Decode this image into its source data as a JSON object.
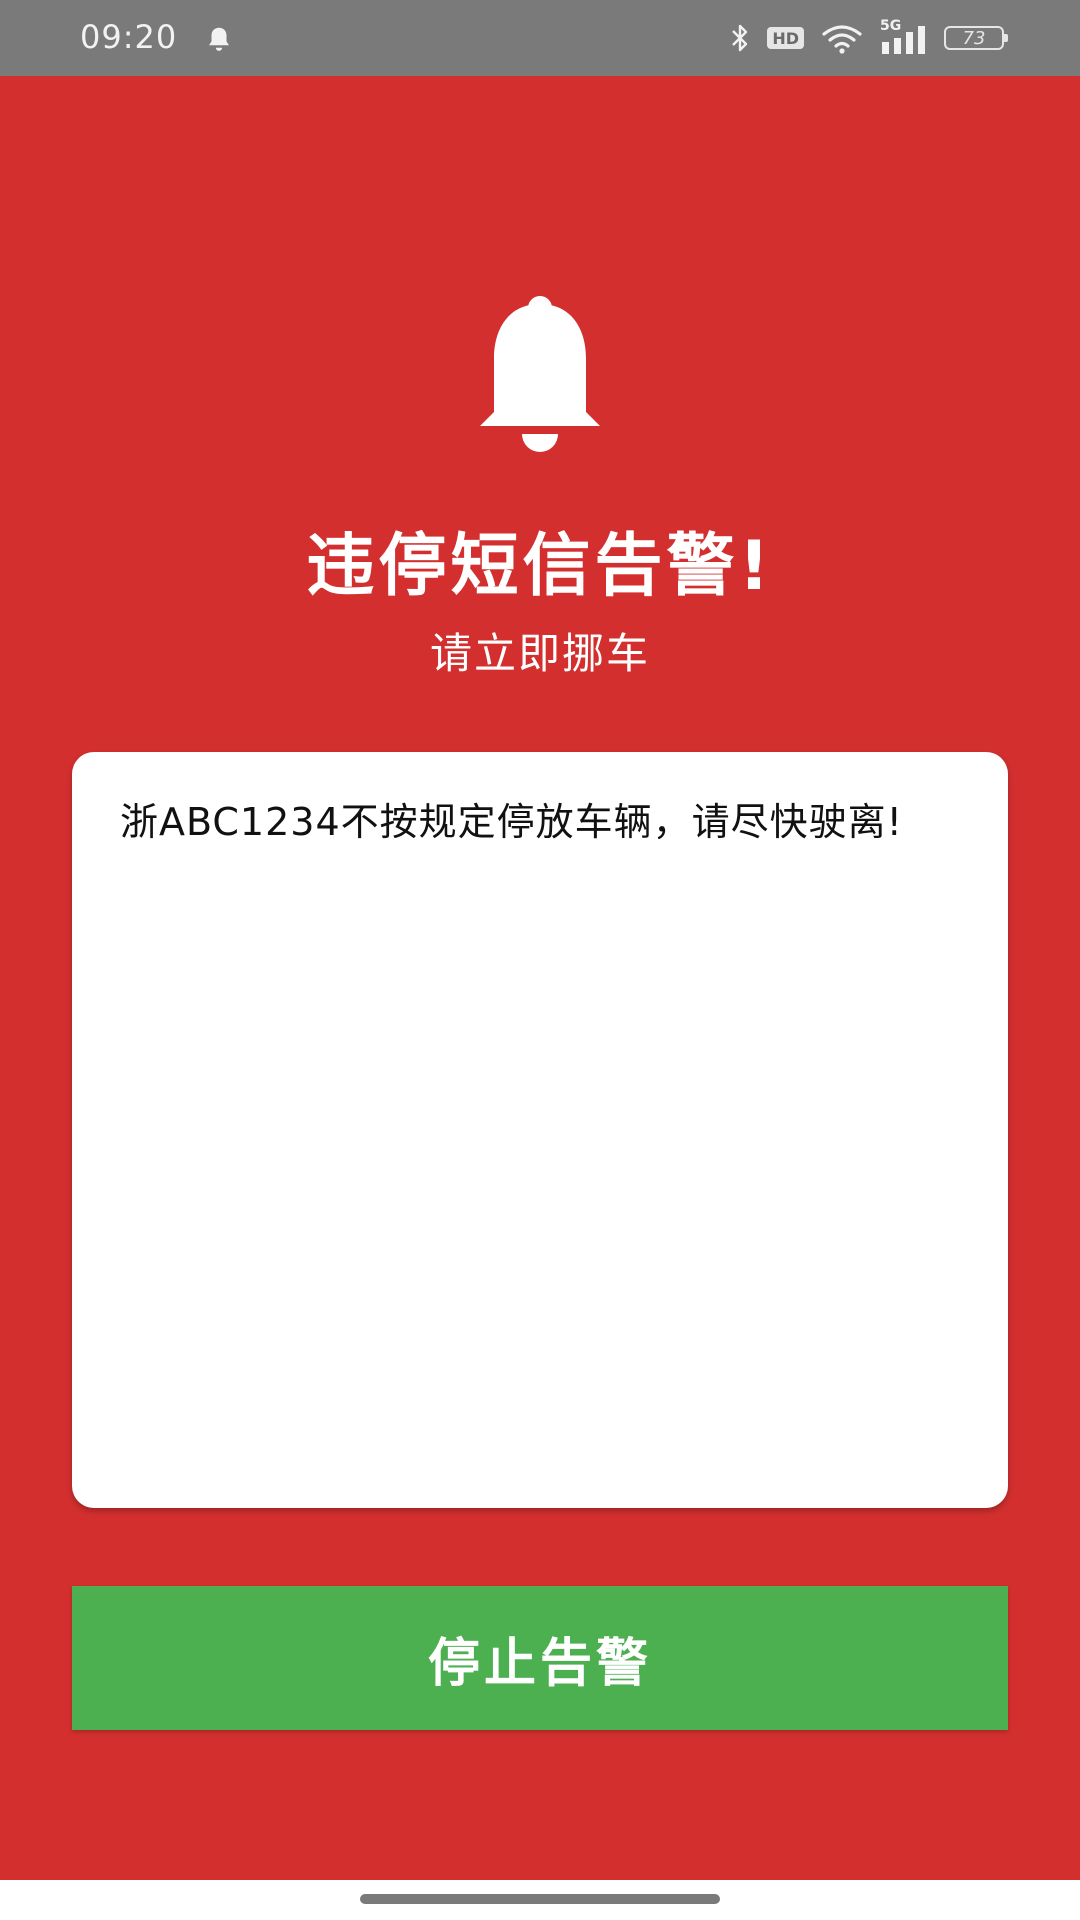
{
  "status_bar": {
    "time": "09:20",
    "network_label": "5G",
    "hd_label": "HD",
    "battery_level": "73"
  },
  "alert": {
    "title": "违停短信告警!",
    "subtitle": "请立即挪车",
    "message": "浙ABC1234不按规定停放车辆，请尽快驶离!",
    "stop_button_label": "停止告警"
  },
  "colors": {
    "background": "#d32f2f",
    "button": "#4caf50",
    "status_bar": "#7a7a7a"
  },
  "icons": {
    "status_notification": "bell-icon",
    "alarm": "bell-icon"
  }
}
